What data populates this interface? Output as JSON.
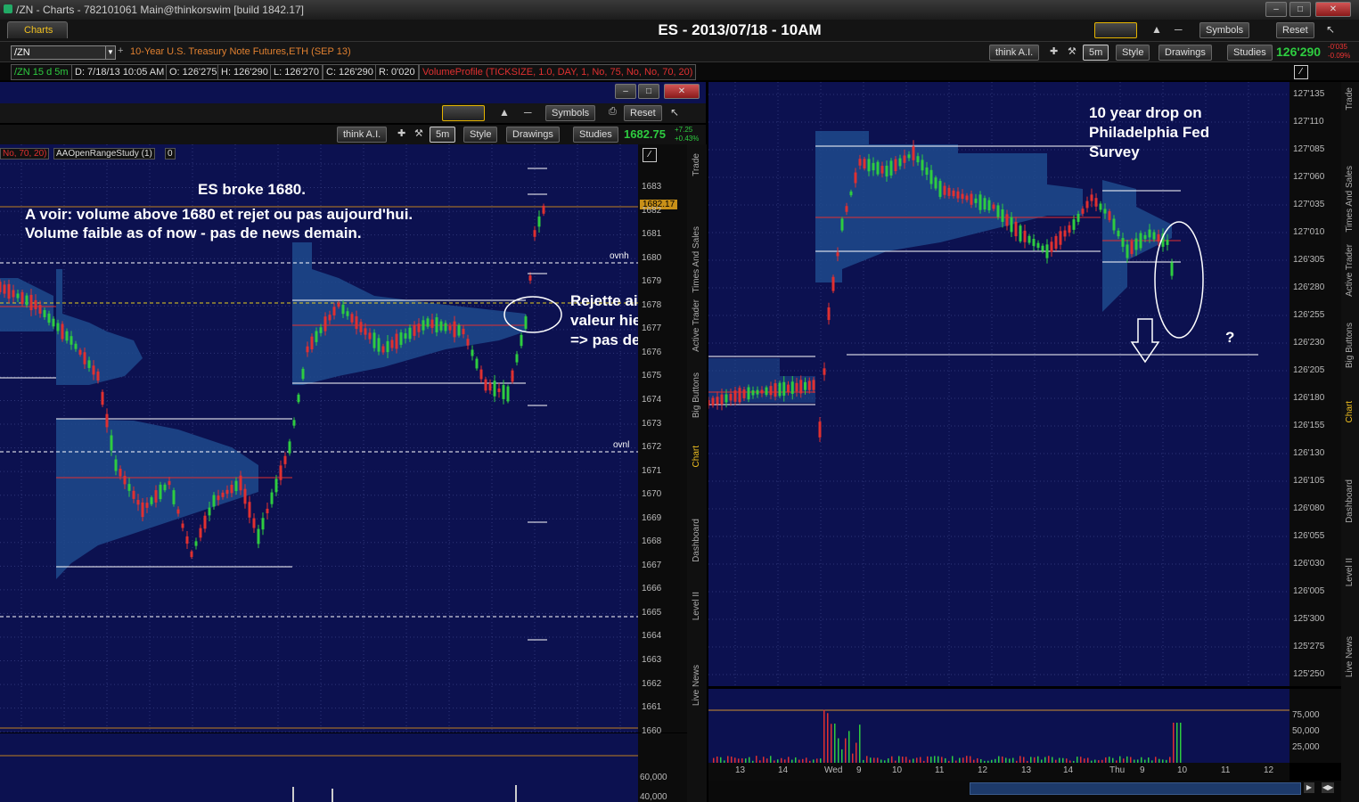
{
  "window": {
    "title": "/ZN - Charts - 782101061 Main@thinkorswim [build 1842.17]",
    "center_title": "ES - 2013/07/18 - 10AM",
    "symbols_label": "Symbols",
    "reset_label": "Reset",
    "charts_tab": "Charts"
  },
  "symbol_bar": {
    "symbol": "/ZN",
    "description": "10-Year U.S. Treasury Note Futures,ETH (SEP 13)"
  },
  "right_toolbar": {
    "think": "think A.I.",
    "period": "5m",
    "style": "Style",
    "drawings": "Drawings",
    "studies": "Studies",
    "price": "126'290",
    "change1": "-0'035",
    "change2": "-0.09%"
  },
  "info_bar": {
    "name": "/ZN 15 d 5m",
    "date": "D: 7/18/13 10:05 AM",
    "open": "O: 126'275",
    "high": "H: 126'290",
    "low": "L: 126'270",
    "close": "C: 126'290",
    "range": "R: 0'020",
    "study": "VolumeProfile (TICKSIZE, 1.0, DAY, 1, No, 75, No, No, 70, 20)"
  },
  "left_window": {
    "symbols_label": "Symbols",
    "reset_label": "Reset",
    "think": "think A.I.",
    "period": "5m",
    "style": "Style",
    "drawings": "Drawings",
    "studies": "Studies",
    "price": "1682.75",
    "change1": "+7.25",
    "change2": "+0.43%",
    "study_a": "No, 70, 20)",
    "study_b": "AAOpenRangeStudy (1)",
    "study_c": "0",
    "price_tag": "1682.17",
    "ovnh": "ovnh",
    "ovnl": "ovnl",
    "note1": "ES broke 1680.",
    "note2": "A voir: volume above 1680 et rejet ou pas aujourd'hui.",
    "note3": "Volume faible as of now - pas de news demain.",
    "note4": "Rejette aire",
    "note5": "valeur hier.",
    "note6": "=> pas de short",
    "y_labels": [
      "1683",
      "1682",
      "1681",
      "1680",
      "1679",
      "1678",
      "1677",
      "1676",
      "1675",
      "1674",
      "1673",
      "1672",
      "1671",
      "1670",
      "1669",
      "1668",
      "1667",
      "1666",
      "1665",
      "1664",
      "1663",
      "1662",
      "1661",
      "1660"
    ],
    "vol_labels": [
      "60,000",
      "40,000"
    ],
    "vtabs": [
      "Trade",
      "Times And Sales",
      "Active Trader",
      "Big Buttons",
      "Chart",
      "Dashboard",
      "Level II",
      "Live News"
    ]
  },
  "right_chart": {
    "note1": "10 year drop on",
    "note2": "Philadelphia Fed",
    "note3": "Survey",
    "question": "?",
    "y_labels": [
      "127'135",
      "127'110",
      "127'085",
      "127'060",
      "127'035",
      "127'010",
      "126'305",
      "126'280",
      "126'255",
      "126'230",
      "126'205",
      "126'180",
      "126'155",
      "126'130",
      "126'105",
      "126'080",
      "126'055",
      "126'030",
      "126'005",
      "125'300",
      "125'275",
      "125'250"
    ],
    "vol_labels": [
      "75,000",
      "50,000",
      "25,000"
    ],
    "x_labels": [
      "13",
      "14",
      "Wed",
      "9",
      "10",
      "11",
      "12",
      "13",
      "14",
      "Thu",
      "9",
      "10",
      "11",
      "12"
    ],
    "vtabs": [
      "Trade",
      "Times And Sales",
      "Active Trader",
      "Big Buttons",
      "Chart",
      "Dashboard",
      "Level II",
      "Live News"
    ]
  }
}
